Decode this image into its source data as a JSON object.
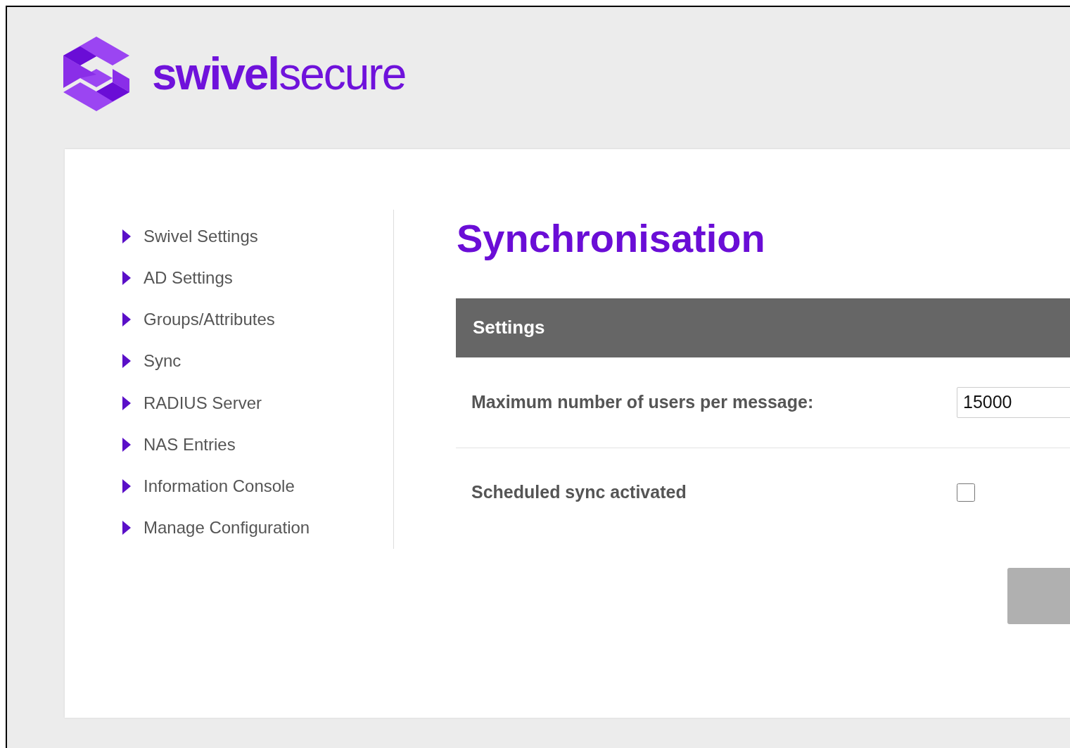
{
  "logo": {
    "text": "**swivel**secure"
  },
  "sidebar": {
    "items": [
      {
        "label": "Swivel Settings"
      },
      {
        "label": "AD Settings"
      },
      {
        "label": "Groups/Attributes"
      },
      {
        "label": "Sync"
      },
      {
        "label": "RADIUS Server"
      },
      {
        "label": "NAS Entries"
      },
      {
        "label": "Information Console"
      },
      {
        "label": "Manage Configuration"
      }
    ]
  },
  "page_title": "Synchronisation",
  "section": {
    "title": "Settings",
    "rows": [
      {
        "kind": "text",
        "label": "Maximum number of users per message:",
        "value": "15000"
      },
      {
        "kind": "checkbox",
        "label": "Scheduled sync activated",
        "checked": false
      }
    ]
  },
  "submit_button": {
    "disabled": true
  }
}
